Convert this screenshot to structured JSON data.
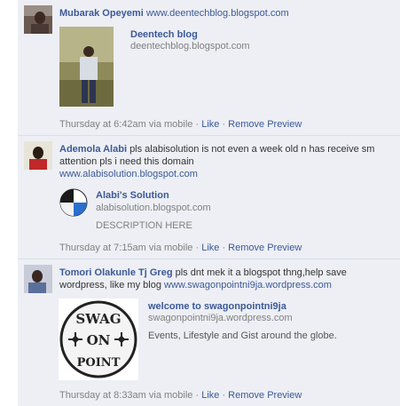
{
  "comments": [
    {
      "author": "Mubarak Opeyemi",
      "text": "",
      "link": "www.deentechblog.blogspot.com",
      "preview": {
        "title": "Deentech blog",
        "domain": "deentechblog.blogspot.com",
        "description": ""
      },
      "time": "Thursday at 6:42am via mobile",
      "sep": " · ",
      "like": "Like",
      "remove": "Remove Preview"
    },
    {
      "author": "Ademola Alabi",
      "text": "pls alabisolution is not even a week old n has receive sm attention pls i need this domain",
      "link": "www.alabisolution.blogspot.com",
      "preview": {
        "title": "Alabi's Solution",
        "domain": "alabisolution.blogspot.com",
        "description": "DESCRIPTION HERE"
      },
      "time": "Thursday at 7:15am via mobile",
      "sep": " · ",
      "like": "Like",
      "remove": "Remove Preview"
    },
    {
      "author": "Tomori Olakunle Tj Greg",
      "text": "pls dnt mek it a blogspot thng,help save wordpress, like my blog",
      "link": "www.swagonpointni9ja.wordpress.com",
      "preview": {
        "title": "welcome to swagonpointni9ja",
        "domain": "swagonpointni9ja.wordpress.com",
        "description": "Events, Lifestyle and Gist around the globe.",
        "logo_text": [
          "SWAG",
          "ON",
          "POINT"
        ]
      },
      "time": "Thursday at 8:33am via mobile",
      "sep": " · ",
      "like": "Like",
      "remove": "Remove Preview"
    }
  ]
}
